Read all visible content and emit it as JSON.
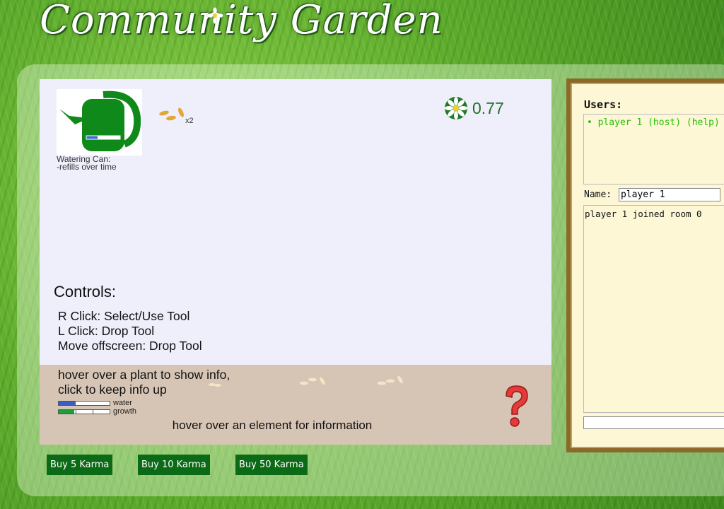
{
  "header": {
    "title": "Community Garden"
  },
  "game": {
    "tool": {
      "name": "Watering Can:",
      "desc": "-refills over time"
    },
    "seeds": {
      "count": "x2"
    },
    "karma": {
      "value": "0.77"
    },
    "controls": {
      "title": "Controls:",
      "lines": [
        "R Click: Select/Use Tool",
        "L Click: Drop Tool",
        "Move offscreen: Drop Tool"
      ]
    },
    "soil": {
      "hint_line1": "hover over a plant to show info,",
      "hint_line2": "click to keep info up",
      "legend_water": "water",
      "legend_growth": "growth",
      "water_level": 0.33,
      "growth_level": 0.3,
      "info": "hover over an element for information"
    }
  },
  "buttons": [
    {
      "label": "Buy 5 Karma"
    },
    {
      "label": "Buy 10 Karma"
    },
    {
      "label": "Buy 50 Karma"
    }
  ],
  "sidebar": {
    "users_title": "Users:",
    "users": [
      "• player 1 (host) (help)"
    ],
    "name_label": "Name:",
    "name_value": "player 1",
    "chat": [
      "player 1 joined room 0"
    ]
  },
  "colors": {
    "user_online": "#22c000",
    "buy_button": "#0b6a15",
    "karma_text": "#1f6f2a"
  }
}
